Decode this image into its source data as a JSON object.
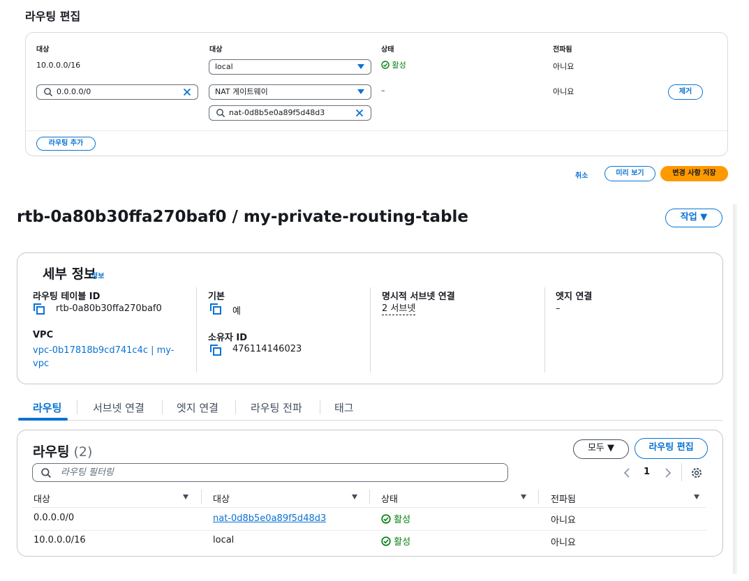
{
  "edit": {
    "title": "라우팅 편집",
    "columns": [
      "대상",
      "대상",
      "상태",
      "전파됨"
    ],
    "rows": [
      {
        "destination": "10.0.0.0/16",
        "target_select": "local",
        "status": "활성",
        "propagated": "아니요"
      },
      {
        "destination_search": "0.0.0.0/0",
        "target_select": "NAT 게이트웨이",
        "target_search": "nat-0d8b5e0a89f5d48d3",
        "status": "–",
        "propagated": "아니요",
        "remove_label": "제거"
      }
    ],
    "add_route_label": "라우팅 추가",
    "cancel_label": "취소",
    "preview_label": "미리 보기",
    "save_label": "변경 사항 저장"
  },
  "page": {
    "title": "rtb-0a80b30ffa270baf0 / my-private-routing-table",
    "actions_label": "작업 ▼"
  },
  "details": {
    "heading": "세부 정보",
    "info_link": "정보",
    "route_table_id_label": "라우팅 테이블 ID",
    "route_table_id": "rtb-0a80b30ffa270baf0",
    "vpc_label": "VPC",
    "vpc_line1": "vpc-0b17818b9cd741c4c | my-",
    "vpc_line2": "vpc",
    "main_label": "기본",
    "main_value": "예",
    "owner_label": "소유자 ID",
    "owner_value": "476114146023",
    "explicit_subnet_label": "명시적 서브넷 연결",
    "explicit_subnet_value": "2 서브넷",
    "edge_label": "엣지 연결",
    "edge_value": "–"
  },
  "tabs": [
    "라우팅",
    "서브넷 연결",
    "엣지 연결",
    "라우팅 전파",
    "태그"
  ],
  "routes": {
    "heading": "라우팅",
    "count": "(2)",
    "filter_select": "모두 ▼",
    "edit_button": "라우팅 편집",
    "search_placeholder": "라우팅 필터링",
    "page_number": "1",
    "columns": [
      "대상",
      "대상",
      "상태",
      "전파됨"
    ],
    "rows": [
      {
        "destination": "0.0.0.0/0",
        "target": "nat-0d8b5e0a89f5d48d3",
        "status": "활성",
        "propagated": "아니요"
      },
      {
        "destination": "10.0.0.0/16",
        "target": "local",
        "status": "활성",
        "propagated": "아니요"
      }
    ]
  },
  "colors": {
    "link": "#0972d3",
    "success": "#037f0c",
    "primary": "#ff9900"
  },
  "icons": [
    "search-icon",
    "clear-icon",
    "caret-down-icon",
    "check-circle-icon",
    "copy-icon",
    "chevron-left-icon",
    "chevron-right-icon",
    "gear-icon",
    "sort-icon"
  ]
}
